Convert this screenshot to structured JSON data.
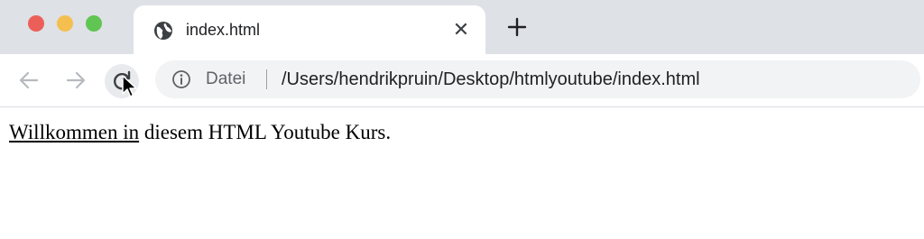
{
  "window": {
    "traffic_lights": [
      "#ec5f59",
      "#f4bf4f",
      "#61c554"
    ]
  },
  "tab": {
    "icon": "globe-icon",
    "title": "index.html",
    "close_label": "✕"
  },
  "toolbar": {
    "new_tab_icon": "plus-icon",
    "back_icon": "arrow-left-icon",
    "forward_icon": "arrow-right-icon",
    "reload_icon": "reload-icon"
  },
  "address_bar": {
    "info_icon": "info-icon",
    "scheme_label": "Datei",
    "url": "/Users/hendrikpruin/Desktop/htmlyoutube/index.html"
  },
  "page": {
    "underlined_text": "Willkommen in",
    "rest_text": " diesem HTML Youtube Kurs."
  }
}
